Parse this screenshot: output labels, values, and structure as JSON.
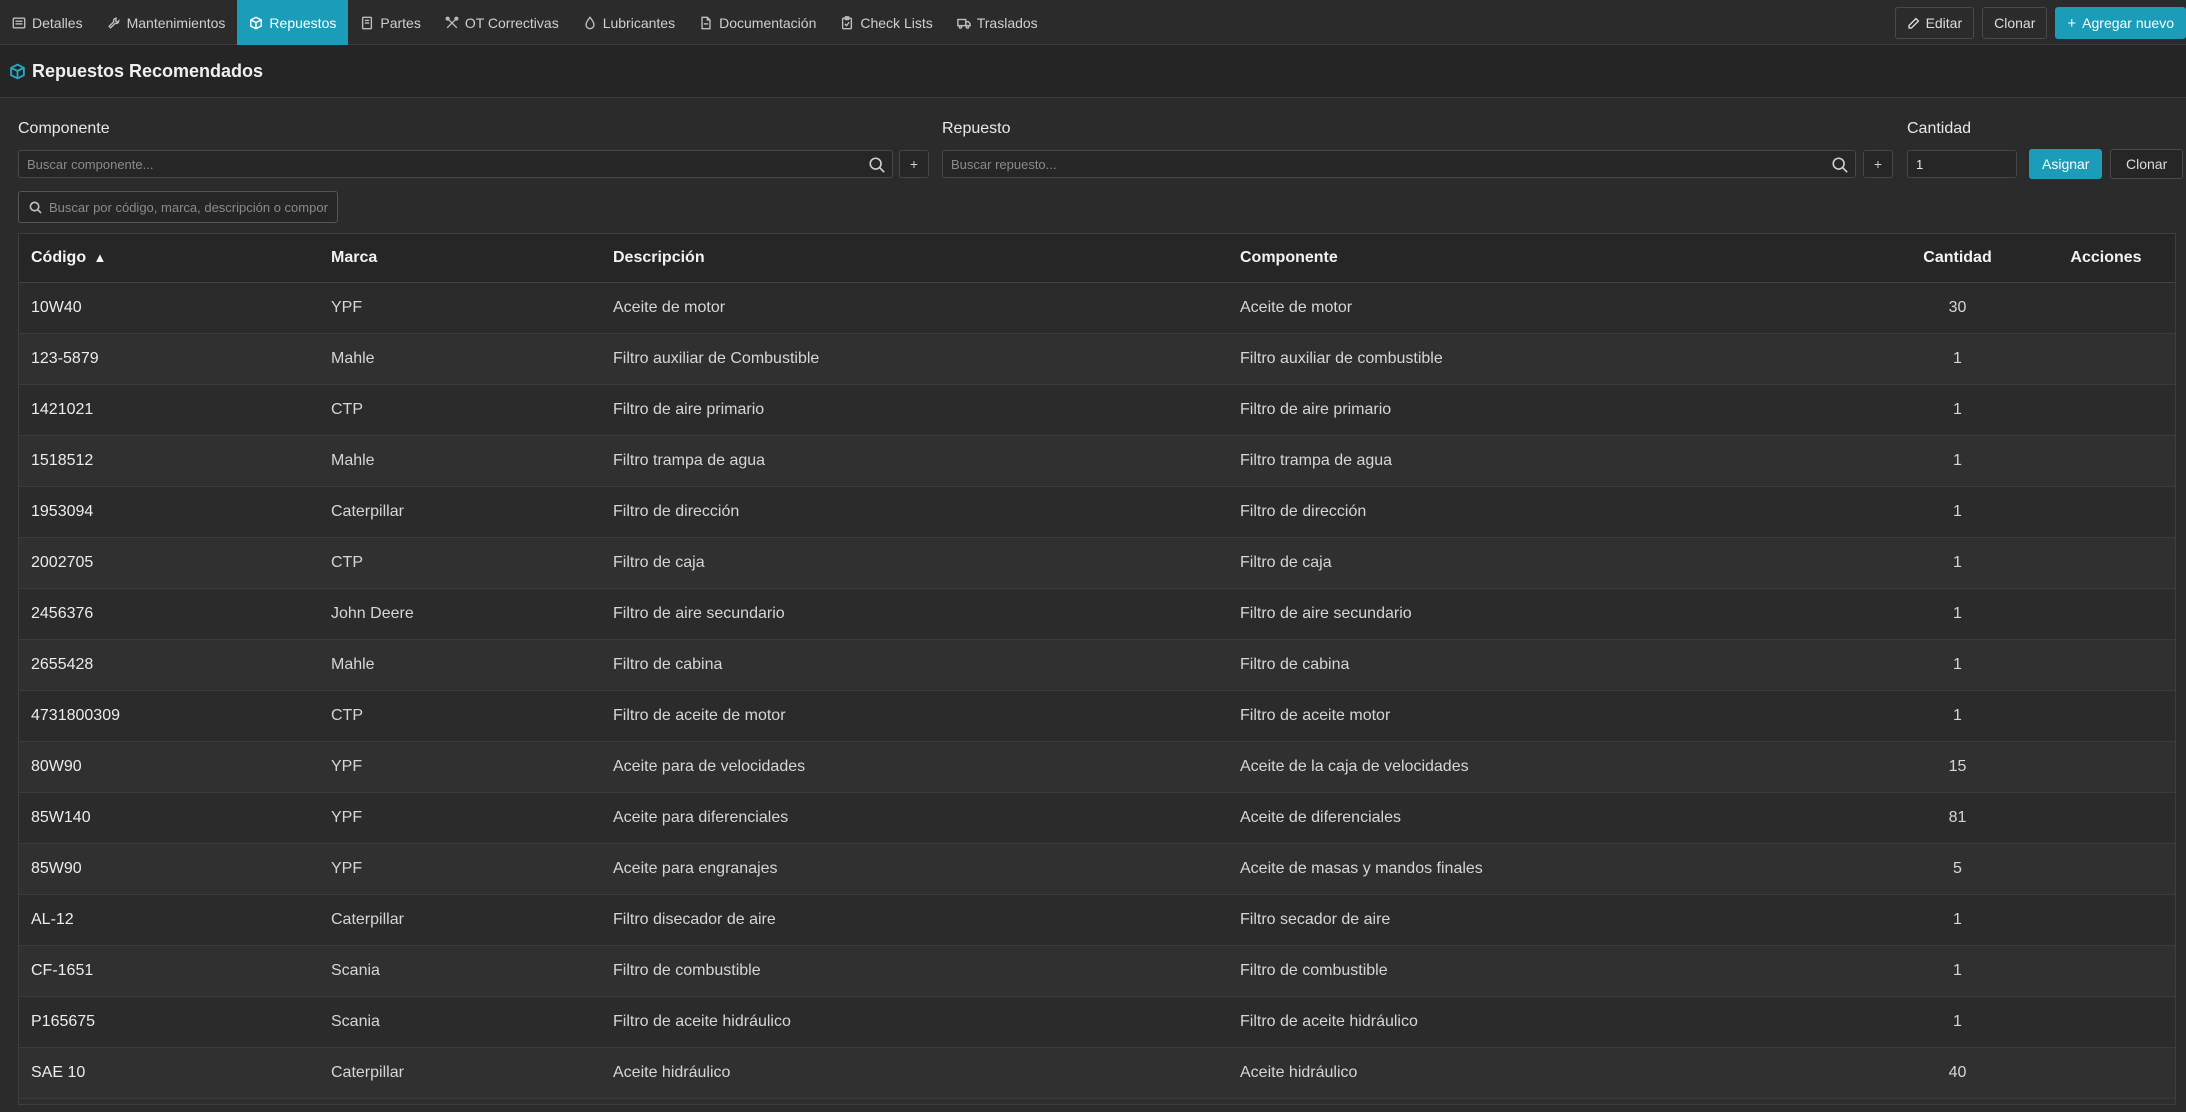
{
  "tabs": [
    {
      "label": "Detalles",
      "icon": "details-icon"
    },
    {
      "label": "Mantenimientos",
      "icon": "wrench-icon"
    },
    {
      "label": "Repuestos",
      "icon": "box-icon",
      "active": true
    },
    {
      "label": "Partes",
      "icon": "document-icon"
    },
    {
      "label": "OT Correctivas",
      "icon": "tools-icon"
    },
    {
      "label": "Lubricantes",
      "icon": "drop-icon"
    },
    {
      "label": "Documentación",
      "icon": "file-icon"
    },
    {
      "label": "Check Lists",
      "icon": "clipboard-icon"
    },
    {
      "label": "Traslados",
      "icon": "truck-icon"
    }
  ],
  "header_actions": {
    "edit": "Editar",
    "clone": "Clonar",
    "add_new": "Agregar nuevo"
  },
  "section": {
    "title": "Repuestos Recomendados",
    "icon": "box-icon"
  },
  "form": {
    "component_label": "Componente",
    "component_placeholder": "Buscar componente...",
    "spare_label": "Repuesto",
    "spare_placeholder": "Buscar repuesto...",
    "quantity_label": "Cantidad",
    "quantity_value": "1",
    "add_symbol": "+",
    "assign": "Asignar",
    "clear": "Clonar"
  },
  "filter": {
    "placeholder": "Buscar por código, marca, descripción o compor"
  },
  "table": {
    "columns": {
      "code": "Código",
      "sort_indicator": "▲",
      "brand": "Marca",
      "description": "Descripción",
      "component": "Componente",
      "quantity": "Cantidad",
      "actions": "Acciones"
    },
    "rows": [
      {
        "code": "10W40",
        "brand": "YPF",
        "description": "Aceite de motor",
        "component": "Aceite de motor",
        "quantity": "30"
      },
      {
        "code": "123-5879",
        "brand": "Mahle",
        "description": "Filtro auxiliar de Combustible",
        "component": "Filtro auxiliar de combustible",
        "quantity": "1"
      },
      {
        "code": "1421021",
        "brand": "CTP",
        "description": "Filtro de aire primario",
        "component": "Filtro de aire primario",
        "quantity": "1"
      },
      {
        "code": "1518512",
        "brand": "Mahle",
        "description": "Filtro trampa de agua",
        "component": "Filtro trampa de agua",
        "quantity": "1"
      },
      {
        "code": "1953094",
        "brand": "Caterpillar",
        "description": "Filtro de dirección",
        "component": "Filtro de dirección",
        "quantity": "1"
      },
      {
        "code": "2002705",
        "brand": "CTP",
        "description": "Filtro de caja",
        "component": "Filtro de caja",
        "quantity": "1"
      },
      {
        "code": "2456376",
        "brand": "John Deere",
        "description": "Filtro de aire secundario",
        "component": "Filtro de aire secundario",
        "quantity": "1"
      },
      {
        "code": "2655428",
        "brand": "Mahle",
        "description": "Filtro de cabina",
        "component": "Filtro de cabina",
        "quantity": "1"
      },
      {
        "code": "4731800309",
        "brand": "CTP",
        "description": "Filtro de aceite de motor",
        "component": "Filtro de aceite motor",
        "quantity": "1"
      },
      {
        "code": "80W90",
        "brand": "YPF",
        "description": "Aceite para de velocidades",
        "component": "Aceite de la caja de velocidades",
        "quantity": "15"
      },
      {
        "code": "85W140",
        "brand": "YPF",
        "description": "Aceite para diferenciales",
        "component": "Aceite de diferenciales",
        "quantity": "81"
      },
      {
        "code": "85W90",
        "brand": "YPF",
        "description": "Aceite para engranajes",
        "component": "Aceite de masas y mandos finales",
        "quantity": "5"
      },
      {
        "code": "AL-12",
        "brand": "Caterpillar",
        "description": "Filtro disecador de aire",
        "component": "Filtro secador de aire",
        "quantity": "1"
      },
      {
        "code": "CF-1651",
        "brand": "Scania",
        "description": "Filtro de combustible",
        "component": "Filtro de combustible",
        "quantity": "1"
      },
      {
        "code": "P165675",
        "brand": "Scania",
        "description": "Filtro de aceite hidráulico",
        "component": "Filtro de aceite hidráulico",
        "quantity": "1"
      },
      {
        "code": "SAE 10",
        "brand": "Caterpillar",
        "description": "Aceite hidráulico",
        "component": "Aceite hidráulico",
        "quantity": "40"
      }
    ]
  },
  "colors": {
    "accent": "#1b9cb8",
    "background": "#1e1e1e",
    "panel": "#2b2b2b"
  }
}
